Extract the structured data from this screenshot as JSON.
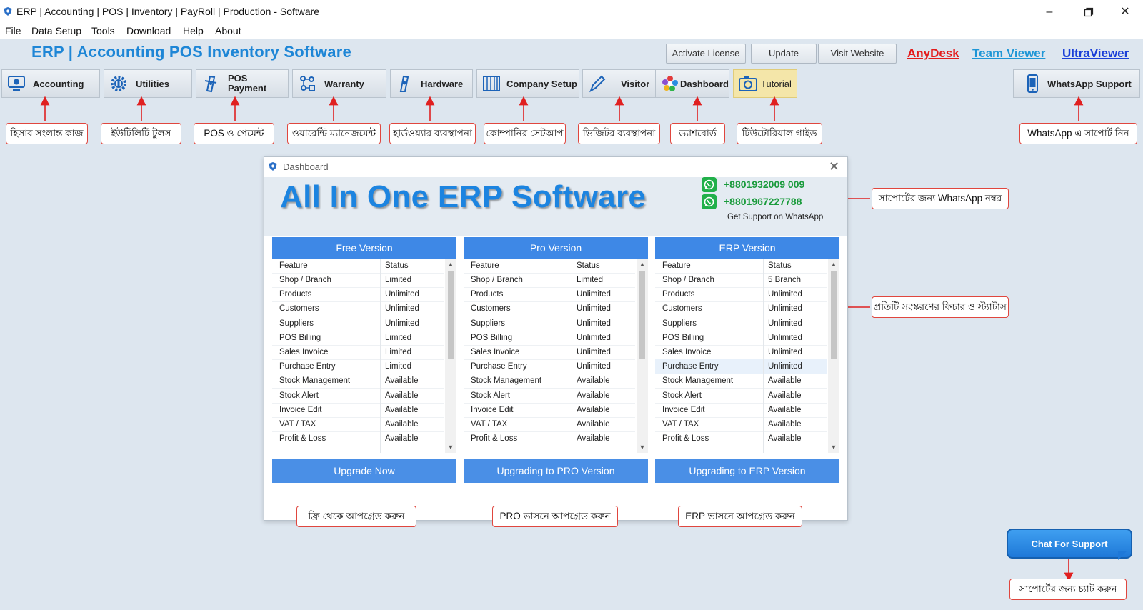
{
  "window": {
    "title": "ERP | Accounting | POS | Inventory | PayRoll | Production - Software",
    "icon": "shield-app-icon",
    "controls": [
      "minimize-icon",
      "restore-icon",
      "close-icon"
    ]
  },
  "menu": [
    "File",
    "Data Setup",
    "Tools",
    "Download",
    "Help",
    "About"
  ],
  "header": {
    "title": "ERP | Accounting POS Inventory Software",
    "buttons": [
      "Activate License",
      "Update",
      "Visit Website"
    ],
    "links": [
      {
        "label": "AnyDesk",
        "color": "#e31b1b"
      },
      {
        "label": "Team Viewer",
        "color": "#1e96d6"
      },
      {
        "label": "UltraViewer",
        "color": "#1a3fd8"
      }
    ]
  },
  "toolbar": [
    {
      "label": "Accounting",
      "icon": "monitor-icon"
    },
    {
      "label": "Utilities",
      "icon": "gear-icon"
    },
    {
      "label": "POS\nPayment",
      "icon": "pos-card-icon"
    },
    {
      "label": "Warranty",
      "icon": "people-network-icon"
    },
    {
      "label": "Hardware",
      "icon": "barcode-scanner-icon"
    },
    {
      "label": "Company Setup",
      "icon": "building-icon"
    },
    {
      "label": "Visitor",
      "icon": "visitor-pen-icon"
    },
    {
      "label": "Dashboard",
      "icon": "flower-dashboard-icon"
    },
    {
      "label": "Tutorial",
      "icon": "camera-tutorial-icon",
      "active": true
    },
    {
      "label": "WhatsApp Support",
      "icon": "phone-icon"
    }
  ],
  "callouts": {
    "toolbar": [
      "হিসাব সংলান্ত কাজ",
      "ইউটিলিটি টুলস",
      "POS ও পেমেন্ট",
      "ওয়ারেন্টি ম্যানেজমেন্ট",
      "হার্ডওয়্যার ব্যবস্থাপনা",
      "কোম্পানির সেটআপ",
      "ভিজিটর ব্যবস্থাপনা",
      "ড্যাশবোর্ড",
      "টিউটোরিয়াল গাইড",
      "WhatsApp এ সাপোর্ট নিন"
    ],
    "whatsapp_number": "সাপোর্টের জন্য WhatsApp নম্বর",
    "features": "প্রতিটি সংস্করণের ফিচার ও স্ট্যাটাস",
    "upgrades": [
      "ফ্রি থেকে আপগ্রেড করুন",
      "PRO ভাসনে আপগ্রেড করুন",
      "ERP ভাসনে আপগ্রেড করুন"
    ],
    "chat": "সাপোর্টের জন্য চ্যাট করুন"
  },
  "dialog": {
    "title": "Dashboard",
    "headline": "All In One ERP Software",
    "phones": [
      "+8801932009 009",
      "+8801967227788"
    ],
    "phone_caption": "Get Support on WhatsApp",
    "columns_header": [
      "Feature",
      "Status"
    ],
    "panels": [
      {
        "title": "Free Version",
        "rows": [
          [
            "Shop / Branch",
            "Limited"
          ],
          [
            "Products",
            "Unlimited"
          ],
          [
            "Customers",
            "Unlimited"
          ],
          [
            "Suppliers",
            "Unlimited"
          ],
          [
            "POS Billing",
            "Limited"
          ],
          [
            "Sales Invoice",
            "Limited"
          ],
          [
            "Purchase Entry",
            "Limited"
          ],
          [
            "Stock Management",
            "Available"
          ],
          [
            "Stock Alert",
            "Available"
          ],
          [
            "Invoice Edit",
            "Available"
          ],
          [
            "VAT / TAX",
            "Available"
          ],
          [
            "Profit & Loss",
            "Available"
          ]
        ],
        "button": "Upgrade Now"
      },
      {
        "title": "Pro Version",
        "rows": [
          [
            "Shop / Branch",
            "Limited"
          ],
          [
            "Products",
            "Unlimited"
          ],
          [
            "Customers",
            "Unlimited"
          ],
          [
            "Suppliers",
            "Unlimited"
          ],
          [
            "POS Billing",
            "Unlimited"
          ],
          [
            "Sales Invoice",
            "Unlimited"
          ],
          [
            "Purchase Entry",
            "Unlimited"
          ],
          [
            "Stock Management",
            "Available"
          ],
          [
            "Stock Alert",
            "Available"
          ],
          [
            "Invoice Edit",
            "Available"
          ],
          [
            "VAT / TAX",
            "Available"
          ],
          [
            "Profit & Loss",
            "Available"
          ]
        ],
        "button": "Upgrading to PRO Version"
      },
      {
        "title": "ERP Version",
        "rows": [
          [
            "Shop / Branch",
            "5 Branch"
          ],
          [
            "Products",
            "Unlimited"
          ],
          [
            "Customers",
            "Unlimited"
          ],
          [
            "Suppliers",
            "Unlimited"
          ],
          [
            "POS Billing",
            "Unlimited"
          ],
          [
            "Sales Invoice",
            "Unlimited"
          ],
          [
            "Purchase Entry",
            "Unlimited"
          ],
          [
            "Stock Management",
            "Available"
          ],
          [
            "Stock Alert",
            "Available"
          ],
          [
            "Invoice Edit",
            "Available"
          ],
          [
            "VAT / TAX",
            "Available"
          ],
          [
            "Profit & Loss",
            "Available"
          ]
        ],
        "selected_row": "Purchase Entry",
        "button": "Upgrading to ERP Version"
      }
    ]
  },
  "chat_button": "Chat For Support"
}
